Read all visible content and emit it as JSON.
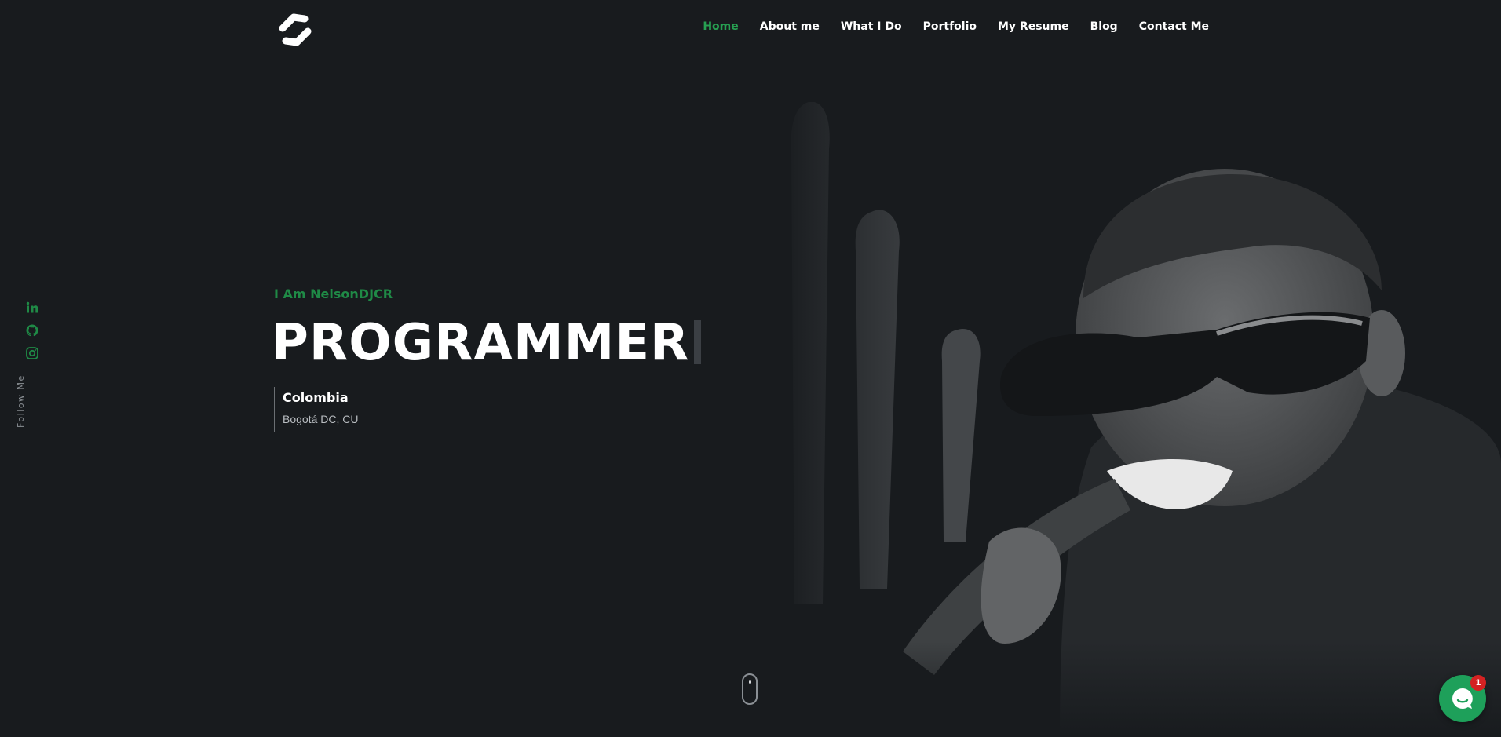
{
  "nav": {
    "items": [
      {
        "label": "Home",
        "active": true
      },
      {
        "label": "About me"
      },
      {
        "label": "What I Do"
      },
      {
        "label": "Portfolio"
      },
      {
        "label": "My Resume"
      },
      {
        "label": "Blog"
      },
      {
        "label": "Contact Me"
      }
    ]
  },
  "social": {
    "icons": [
      "linkedin-icon",
      "github-icon",
      "instagram-icon"
    ],
    "follow_label": "Follow Me",
    "color": "#1f8a46"
  },
  "hero": {
    "intro": "I Am NelsonDJCR",
    "role": "PROGRAMMER",
    "country": "Colombia",
    "city": "Bogotá DC, CU"
  },
  "chat": {
    "badge_count": "1",
    "color": "#1ea05a"
  },
  "colors": {
    "background": "#181b1e",
    "accent": "#27a152"
  }
}
